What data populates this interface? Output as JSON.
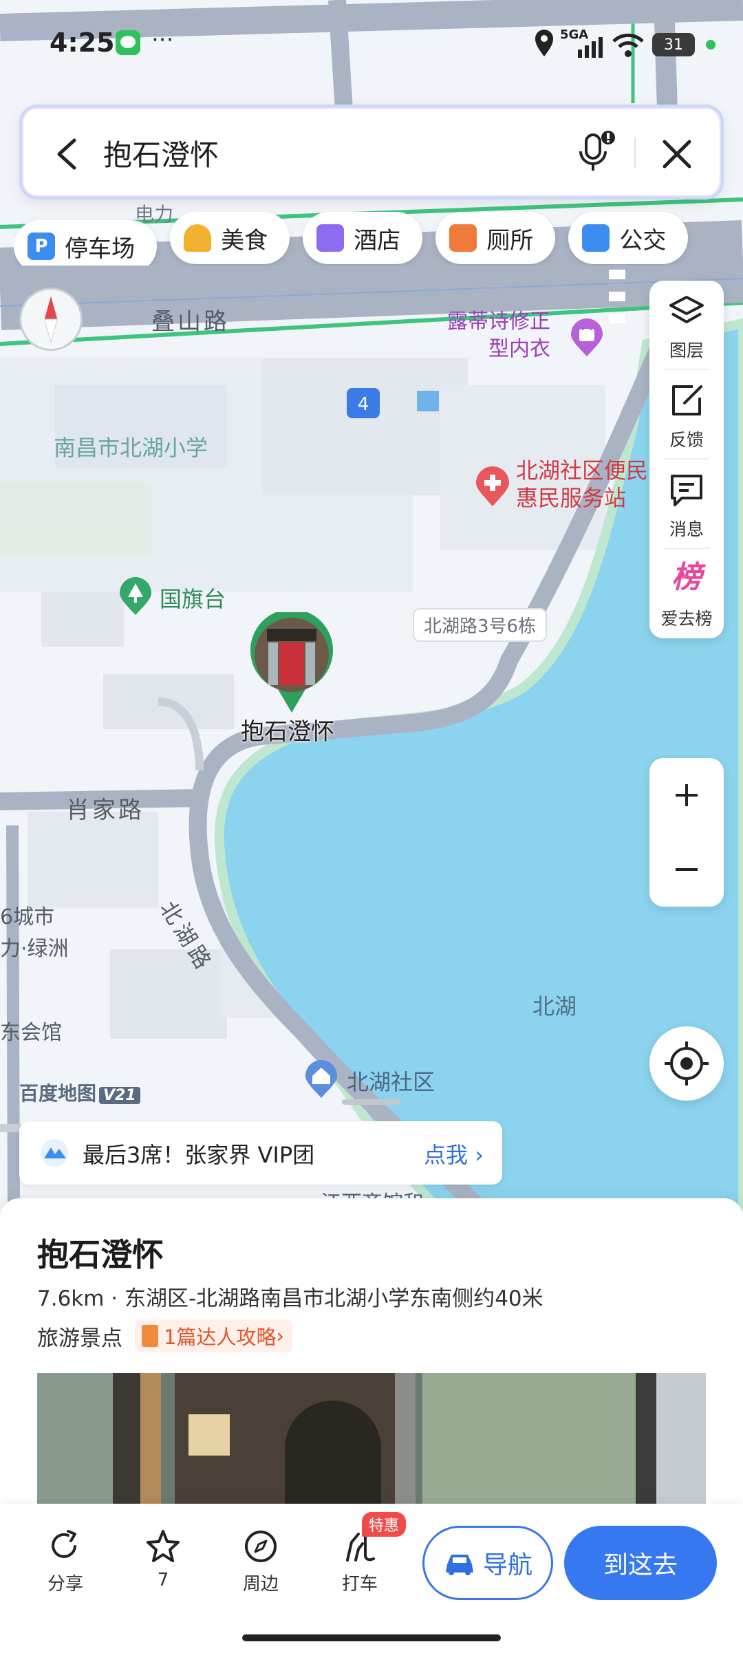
{
  "status_bar": {
    "time": "4:25",
    "network": "5GA",
    "battery": "31",
    "more": "···"
  },
  "search": {
    "query": "抱石澄怀"
  },
  "categories": [
    {
      "label": "停车场",
      "icon": "parking-icon",
      "color": "#3b8df0",
      "glyph": "P"
    },
    {
      "label": "美食",
      "icon": "food-icon",
      "color": "#f2b230",
      "glyph": ""
    },
    {
      "label": "酒店",
      "icon": "hotel-icon",
      "color": "#8e6cf0",
      "glyph": ""
    },
    {
      "label": "厕所",
      "icon": "toilet-icon",
      "color": "#f07a3a",
      "glyph": ""
    },
    {
      "label": "公交",
      "icon": "bus-icon",
      "color": "#3b8df0",
      "glyph": ""
    }
  ],
  "tools": {
    "layers": "图层",
    "feedback": "反馈",
    "messages": "消息",
    "ranking": "爱去榜",
    "ranking_glyph": "榜"
  },
  "map": {
    "roads": {
      "dieshan": "叠山路",
      "xiaojia": "肖家路",
      "beihu_road": "北湖路"
    },
    "pois": {
      "school": "南昌市北湖小学",
      "clinic_line1": "北湖社区便民",
      "clinic_line2": "惠民服务站",
      "shop_line1": "露蒂诗修正",
      "shop_line2": "型内衣",
      "flag": "国旗台",
      "address_chip": "北湖路3号6栋",
      "lake": "北湖",
      "community": "北湖社区",
      "left_1": "6城市",
      "left_2": "力·绿洲",
      "left_3": "东会馆",
      "bottom_cut": "江西齐馆和",
      "top_cut": "电力",
      "route_badge": "4"
    },
    "marker_label": "抱石澄怀",
    "watermark": "百度地图",
    "watermark_version": "V21"
  },
  "promo": {
    "text": "最后3席！张家界 VIP团",
    "link": "点我"
  },
  "place": {
    "title": "抱石澄怀",
    "address": "7.6km · 东湖区-北湖路南昌市北湖小学东南侧约40米",
    "category": "旅游景点",
    "guide": "1篇达人攻略"
  },
  "actions": {
    "share": "分享",
    "favorite_count": "7",
    "nearby": "周边",
    "taxi": "打车",
    "taxi_badge": "特惠",
    "navigate": "导航",
    "go": "到这去"
  }
}
